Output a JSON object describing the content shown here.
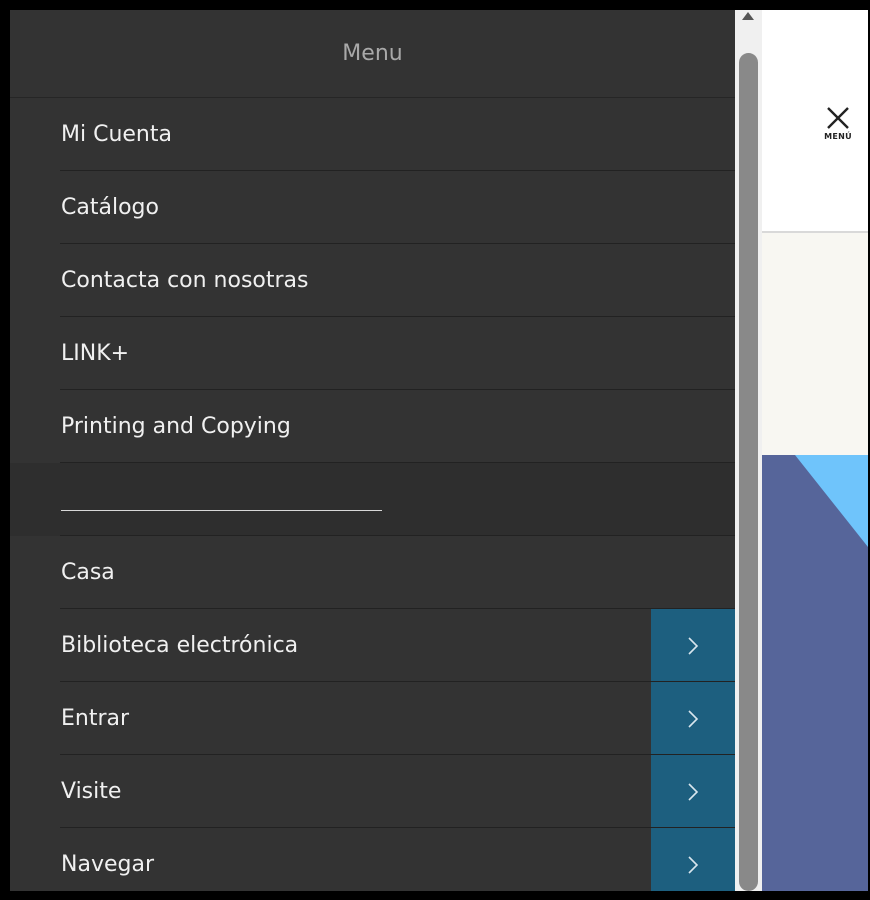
{
  "drawer": {
    "title": "Menu",
    "items": [
      {
        "label": "Mi Cuenta"
      },
      {
        "label": "Catálogo"
      },
      {
        "label": "Contacta con nosotras"
      },
      {
        "label": "LINK+"
      },
      {
        "label": "Printing and Copying"
      },
      {
        "label": ""
      },
      {
        "label": "Casa"
      },
      {
        "label": "Biblioteca electrónica"
      },
      {
        "label": "Entrar"
      },
      {
        "label": "Visite"
      },
      {
        "label": "Navegar"
      }
    ],
    "submenu_icon": "chevron-right-icon"
  },
  "header": {
    "close_menu_caption": "MENÚ",
    "close_icon": "close-icon"
  },
  "colors": {
    "drawer_bg": "#333333",
    "submenu_toggle_bg": "#1d5f7f",
    "hero_blue": "#56659a",
    "hero_light_blue": "#6fc4fb",
    "beige": "#f8f7f2"
  }
}
